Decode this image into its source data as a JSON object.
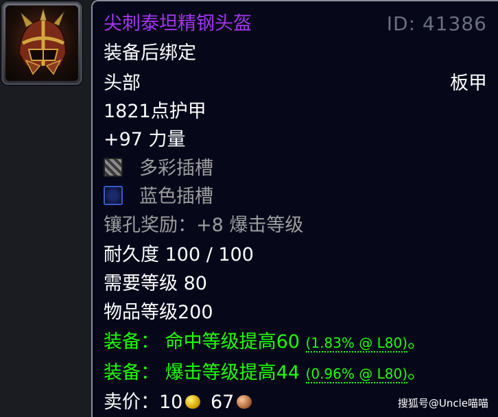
{
  "item": {
    "name": "尖刺泰坦精钢头盔",
    "id_label": "ID: 41386",
    "bind": "装备后绑定",
    "slot": "头部",
    "armor_type": "板甲",
    "armor": "1821点护甲",
    "stat": "+97 力量",
    "sockets": [
      {
        "type": "prismatic",
        "label": "多彩插槽"
      },
      {
        "type": "blue",
        "label": "蓝色插槽"
      }
    ],
    "socket_bonus": "镶孔奖励：+8 爆击等级",
    "durability": "耐久度 100 / 100",
    "required_level": "需要等级 80",
    "item_level": "物品等级200",
    "equip_effects": [
      {
        "prefix": "装备：",
        "text": "命中等级提高60",
        "note": "(1.83% @ L80)",
        "end": "。"
      },
      {
        "prefix": "装备：",
        "text": "爆击等级提高44",
        "note": "(0.96% @ L80)",
        "end": "。"
      }
    ],
    "sell_price": {
      "label": "卖价：",
      "gold": "10",
      "silver": "67"
    }
  },
  "icon": {
    "name": "helmet-icon"
  },
  "watermark": "搜狐号@Uncle喵喵",
  "colors": {
    "epic": "#a335ee",
    "uncommon": "#1eff00",
    "grey": "#9d9d9d",
    "white": "#ffffff"
  }
}
